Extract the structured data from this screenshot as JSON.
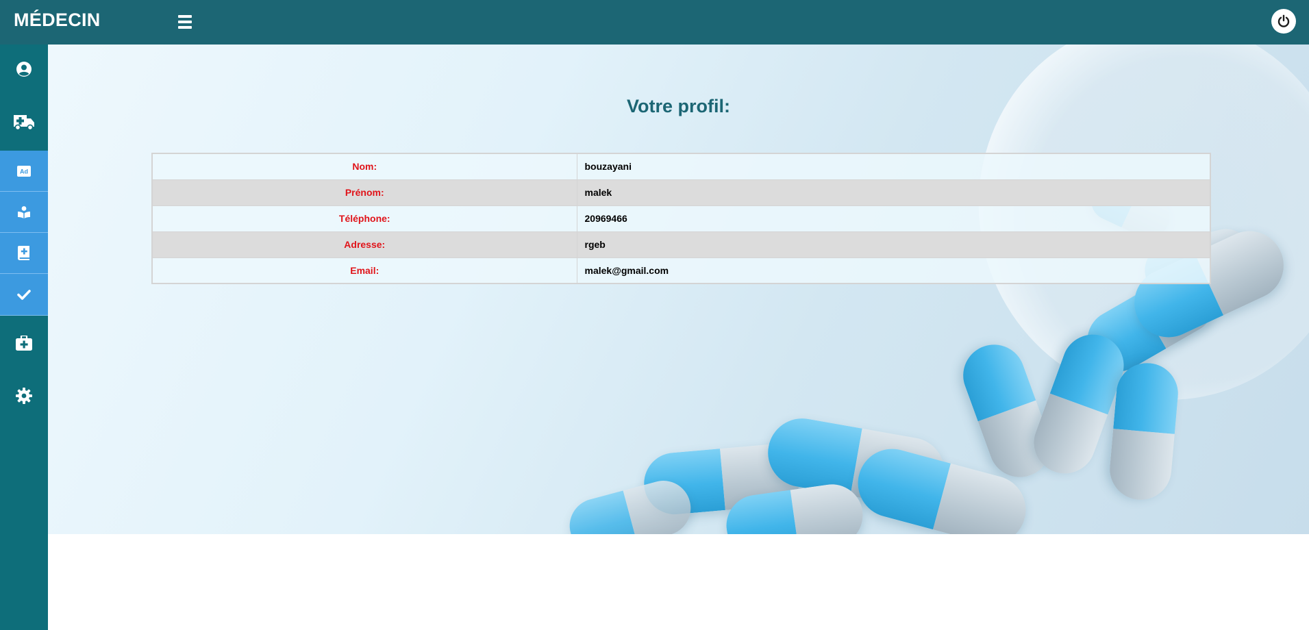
{
  "header": {
    "brand": "MÉDECIN",
    "menu_icon": "bars-icon",
    "logout_icon": "power-icon"
  },
  "sidebar": {
    "items": [
      {
        "icon": "user-circle-icon",
        "active": false
      },
      {
        "icon": "ambulance-icon",
        "active": false
      },
      {
        "icon": "ad-icon",
        "active": true
      },
      {
        "icon": "reader-icon",
        "active": true
      },
      {
        "icon": "medical-book-icon",
        "active": true
      },
      {
        "icon": "check-icon",
        "active": true
      },
      {
        "icon": "medkit-icon",
        "active": false
      },
      {
        "icon": "gear-icon",
        "active": false
      }
    ]
  },
  "main": {
    "title": "Votre profil:",
    "rows": [
      {
        "label": "Nom:",
        "value": "bouzayani"
      },
      {
        "label": "Prénom:",
        "value": "malek"
      },
      {
        "label": "Téléphone:",
        "value": "20969466"
      },
      {
        "label": "Adresse:",
        "value": "rgeb"
      },
      {
        "label": "Email:",
        "value": "malek@gmail.com"
      }
    ]
  },
  "colors": {
    "topbar": "#1c6674",
    "sidebar": "#0e6e7a",
    "sidebar_active": "#3c9ae0",
    "label_text": "#e0141a",
    "title_text": "#1c6674"
  }
}
